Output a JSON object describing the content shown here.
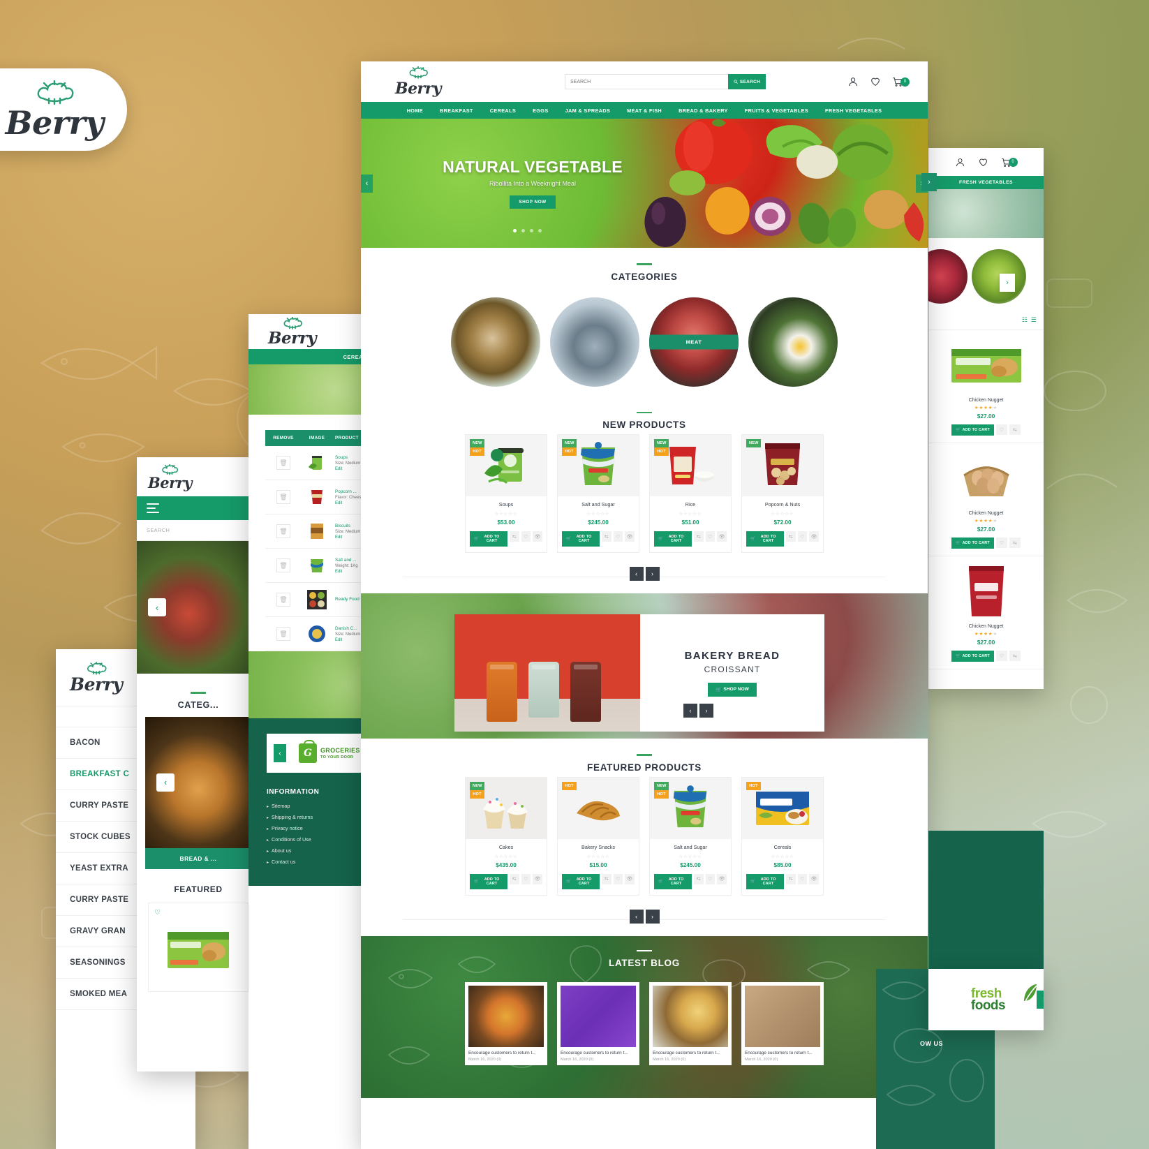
{
  "brand": {
    "name": "Berry",
    "accent": "#159b69",
    "dark": "#2b3340",
    "orange": "#f5a11b",
    "green_badge": "#3faa5e"
  },
  "main": {
    "search": {
      "placeholder": "SEARCH",
      "button": "SEARCH"
    },
    "icons": {
      "account": "user-icon",
      "wishlist": "heart-icon",
      "cart": "cart-icon",
      "cart_count": "0"
    },
    "nav": [
      "HOME",
      "BREAKFAST",
      "CEREALS",
      "EGGS",
      "JAM & SPREADS",
      "MEAT & FISH",
      "BREAD & BAKERY",
      "FRUITS & VEGETABLES",
      "FRESH VEGETABLES"
    ],
    "hero": {
      "title": "NATURAL VEGETABLE",
      "subtitle": "Ribollita Into a Weeknight Meal",
      "button": "SHOP NOW",
      "prev": "‹",
      "next": "›",
      "dots": 4,
      "active_dot": 1
    },
    "categories_section": {
      "title": "CATEGORIES",
      "items": [
        {
          "label": "",
          "image": "fish-bowl"
        },
        {
          "label": "",
          "image": "fish"
        },
        {
          "label": "MEAT",
          "image": "meat"
        },
        {
          "label": "",
          "image": "salad"
        }
      ]
    },
    "new_products": {
      "title": "NEW PRODUCTS",
      "cart_label": "ADD TO CART",
      "items": [
        {
          "name": "Soups",
          "price": "$53.00",
          "badges": [
            "NEW",
            "HOT"
          ]
        },
        {
          "name": "Salt and Sugar",
          "price": "$245.00",
          "badges": [
            "NEW",
            "HOT"
          ]
        },
        {
          "name": "Rice",
          "price": "$51.00",
          "badges": [
            "NEW",
            "HOT"
          ]
        },
        {
          "name": "Popcorn & Nuts",
          "price": "$72.00",
          "badges": [
            "NEW"
          ]
        }
      ]
    },
    "bakery_banner": {
      "title": "BAKERY BREAD",
      "subtitle": "CROISSANT",
      "button": "SHOP NOW"
    },
    "featured_products": {
      "title": "FEATURED PRODUCTS",
      "cart_label": "ADD TO CART",
      "items": [
        {
          "name": "Cakes",
          "price": "$435.00",
          "badges": [
            "NEW",
            "HOT"
          ]
        },
        {
          "name": "Bakery Snacks",
          "price": "$15.00",
          "badges": [
            "HOT"
          ]
        },
        {
          "name": "Salt and Sugar",
          "price": "$245.00",
          "badges": [
            "NEW",
            "HOT"
          ]
        },
        {
          "name": "Cereals",
          "price": "$85.00",
          "badges": [
            "HOT"
          ]
        }
      ]
    },
    "blog": {
      "title": "LATEST BLOG",
      "posts": [
        {
          "caption": "Encourage customers to return t...",
          "date": "March 16, 2020 (0)"
        },
        {
          "caption": "Encourage customers to return t...",
          "date": "March 16, 2020 (0)"
        },
        {
          "caption": "Encourage customers to return t...",
          "date": "March 16, 2020 (0)"
        },
        {
          "caption": "Encourage customers to return t...",
          "date": "March 16, 2020 (0)"
        }
      ]
    },
    "carousel": {
      "prev": "‹",
      "next": "›"
    }
  },
  "right_panel": {
    "nav_label": "FRESH VEGETABLES",
    "icons": {
      "account": "user-icon",
      "wishlist": "heart-icon",
      "cart": "cart-icon",
      "cart_count": "0"
    },
    "view_grid": "grid-view-icon",
    "view_list": "list-view-icon",
    "next_arrow": "›",
    "cart_label": "ADD TO CART",
    "products": [
      {
        "name": "Chicken Nugget",
        "price": "$27.00",
        "rating": 4
      },
      {
        "name": "Chicken Nugget",
        "price": "$27.00",
        "rating": 4
      },
      {
        "name": "Chicken Nugget",
        "price": "$27.00",
        "rating": 4
      }
    ]
  },
  "cereals_panel": {
    "nav_label": "CEREALS",
    "cart_table": {
      "headers": [
        "REMOVE",
        "IMAGE",
        "PRODUCT"
      ],
      "rows": [
        {
          "name": "Soups",
          "meta": "Size: Medium",
          "edit": "Edit"
        },
        {
          "name": "Popcorn ...",
          "meta": "Flavor: Cheese",
          "edit": "Edit"
        },
        {
          "name": "Biscuits",
          "meta": "Size: Medium",
          "edit": "Edit"
        },
        {
          "name": "Salt and ...",
          "meta": "Weight: 1Kg",
          "edit": "Edit"
        },
        {
          "name": "Ready Food",
          "meta": "",
          "edit": ""
        },
        {
          "name": "Danish C...",
          "meta": "Size: Medium",
          "edit": "Edit"
        }
      ]
    },
    "footer": {
      "groceries_logo": {
        "line1": "GROCERIES",
        "line2": "TO YOUR DOOR"
      },
      "prev_arrow": "‹",
      "information_title": "INFORMATION",
      "links": [
        "Sitemap",
        "Shipping & returns",
        "Privacy notice",
        "Conditions of Use",
        "About us",
        "Contact us"
      ]
    }
  },
  "mobile_panel": {
    "search_placeholder": "SEARCH",
    "menu_icon": "hamburger-icon",
    "prev_arrow": "‹",
    "categories_title": "CATEG...",
    "banner_label": "BREAD & ...",
    "featured_title": "FEATURED",
    "wishlist_icon": "heart-icon"
  },
  "category_list_panel": {
    "items": [
      {
        "label": "BACON",
        "active": false
      },
      {
        "label": "BREAKFAST C",
        "active": true
      },
      {
        "label": "CURRY PASTE",
        "active": false
      },
      {
        "label": "STOCK CUBES",
        "active": false
      },
      {
        "label": "YEAST EXTRA",
        "active": false
      },
      {
        "label": "CURRY PASTE",
        "active": false
      },
      {
        "label": "GRAVY GRAN",
        "active": false
      },
      {
        "label": "SEASONINGS",
        "active": false
      },
      {
        "label": "SMOKED MEA",
        "active": false
      }
    ]
  },
  "fresh_foods_panel": {
    "line1": "fresh",
    "line2": "foods",
    "next_arrow": "›",
    "follow_label": "OW US"
  }
}
